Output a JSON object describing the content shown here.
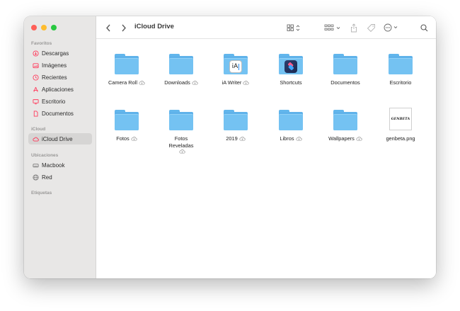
{
  "window": {
    "title": "iCloud Drive"
  },
  "sidebar": {
    "sections": [
      {
        "id": "favoritos",
        "label": "Favoritos"
      },
      {
        "id": "icloud",
        "label": "iCloud"
      },
      {
        "id": "ubicaciones",
        "label": "Ubicaciones"
      },
      {
        "id": "etiquetas",
        "label": "Etiquetas"
      }
    ],
    "favorites": [
      {
        "label": "Descargas",
        "icon": "download-icon"
      },
      {
        "label": "Imágenes",
        "icon": "photo-icon"
      },
      {
        "label": "Recientes",
        "icon": "clock-icon"
      },
      {
        "label": "Aplicaciones",
        "icon": "apps-icon"
      },
      {
        "label": "Escritorio",
        "icon": "desktop-icon"
      },
      {
        "label": "Documentos",
        "icon": "document-icon"
      }
    ],
    "icloud_items": [
      {
        "label": "iCloud Drive",
        "icon": "cloud-icon",
        "active": true
      }
    ],
    "locations": [
      {
        "label": "Macbook",
        "icon": "drive-icon"
      },
      {
        "label": "Red",
        "icon": "network-icon"
      }
    ],
    "accent_color": "#ff3b5c"
  },
  "files": [
    {
      "name": "Camera Roll",
      "type": "folder",
      "cloud": true
    },
    {
      "name": "Downloads",
      "type": "folder",
      "cloud": true
    },
    {
      "name": "iA Writer",
      "type": "app-folder",
      "app": "ia",
      "cloud": true
    },
    {
      "name": "Shortcuts",
      "type": "app-folder",
      "app": "shortcuts",
      "cloud": false
    },
    {
      "name": "Documentos",
      "type": "folder",
      "cloud": false
    },
    {
      "name": "Escritorio",
      "type": "folder",
      "cloud": false
    },
    {
      "name": "Fotos",
      "type": "folder",
      "cloud": true
    },
    {
      "name": "Fotos Reveladas",
      "type": "folder",
      "cloud": true
    },
    {
      "name": "2019",
      "type": "folder",
      "cloud": true
    },
    {
      "name": "Libros",
      "type": "folder",
      "cloud": true
    },
    {
      "name": "Wallpapers",
      "type": "folder",
      "cloud": true
    },
    {
      "name": "genbeta.png",
      "type": "image",
      "thumb_text": "GENBETA",
      "cloud": false
    }
  ],
  "colors": {
    "folder": "#74c2f2",
    "sidebar_bg": "#e8e7e6"
  }
}
